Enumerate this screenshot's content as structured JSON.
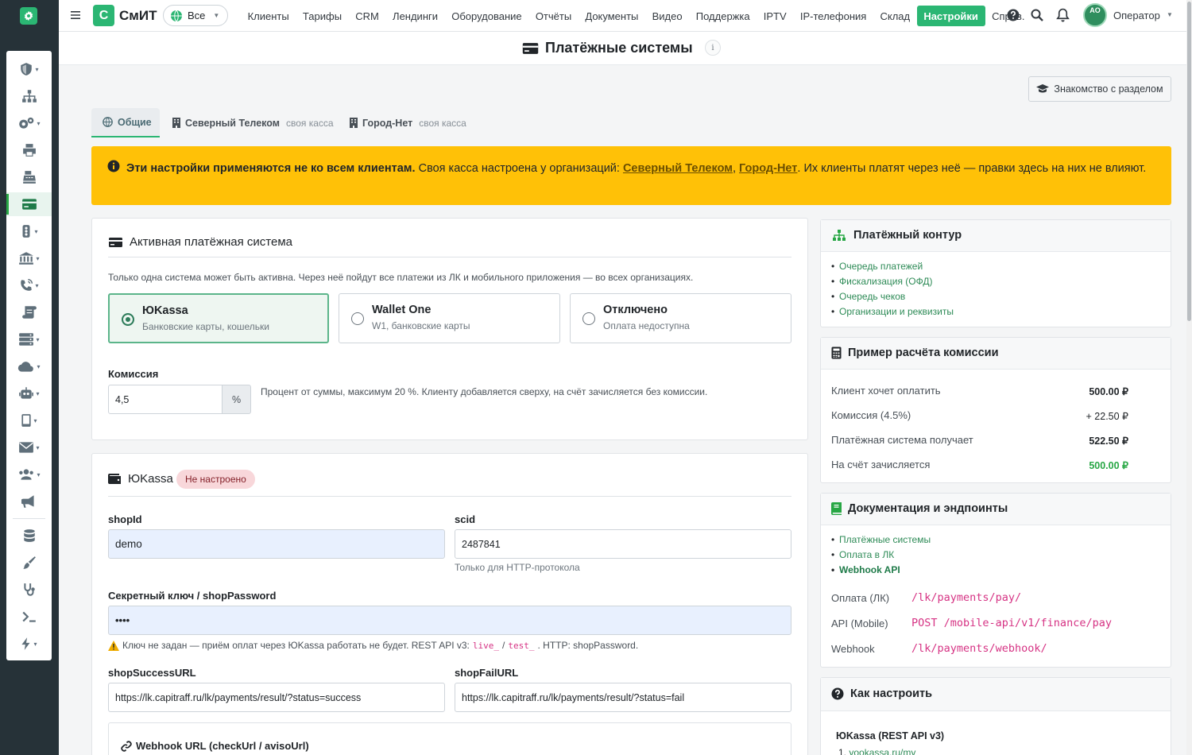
{
  "app": {
    "brand_letter": "С",
    "brand_name": "СмИТ",
    "scope": "Все"
  },
  "nav": [
    "Клиенты",
    "Тарифы",
    "CRM",
    "Лендинги",
    "Оборудование",
    "Отчёты",
    "Документы",
    "Видео",
    "Поддержка",
    "IPTV",
    "IP-телефония",
    "Склад",
    "Настройки",
    "Справ."
  ],
  "nav_active": "Настройки",
  "user": {
    "initials": "AO",
    "name": "Оператор"
  },
  "page": {
    "title": "Платёжные системы",
    "info": "i",
    "intro_button": "Знакомство с разделом"
  },
  "tabs": [
    {
      "label": "Общие",
      "sub": ""
    },
    {
      "label": "Северный Телеком",
      "sub": "своя касса"
    },
    {
      "label": "Город-Нет",
      "sub": "своя касса"
    }
  ],
  "warning": {
    "bold": "Эти настройки применяются не ко всем клиентам.",
    "text1": " Своя касса настроена у организаций: ",
    "org1": "Северный Телеком",
    "sep": ", ",
    "org2": "Город-Нет",
    "text2": ". Их клиенты платят через неё — правки здесь на них не влияют."
  },
  "active_system": {
    "title": "Активная платёжная система",
    "desc": "Только одна система может быть активна. Через неё пойдут все платежи из ЛК и мобильного приложения — во всех организациях.",
    "options": [
      {
        "title": "ЮKassa",
        "sub": "Банковские карты, кошельки",
        "selected": true
      },
      {
        "title": "Wallet One",
        "sub": "W1, банковские карты",
        "selected": false
      },
      {
        "title": "Отключено",
        "sub": "Оплата недоступна",
        "selected": false
      }
    ],
    "commission_label": "Комиссия",
    "commission_value": "4,5",
    "commission_unit": "%",
    "commission_hint": "Процент от суммы, максимум 20 %. Клиенту добавляется сверху, на счёт зачисляется без комиссии."
  },
  "yookassa": {
    "title": "ЮKassa",
    "status": "Не настроено",
    "shopid_label": "shopId",
    "shopid_value": "demo",
    "scid_label": "scid",
    "scid_value": "2487841",
    "scid_hint": "Только для HTTP-протокола",
    "secret_label": "Секретный ключ / shopPassword",
    "secret_value": "••••",
    "secret_hint1": "Ключ не задан — приём оплат через ЮKassa работать не будет. REST API v3: ",
    "secret_code1": "live_",
    "secret_hint_sep": " / ",
    "secret_code2": "test_",
    "secret_hint2": ". HTTP: shopPassword.",
    "success_label": "shopSuccessURL",
    "success_value": "https://lk.capitraff.ru/lk/payments/result/?status=success",
    "fail_label": "shopFailURL",
    "fail_value": "https://lk.capitraff.ru/lk/payments/result/?status=fail",
    "webhook_label": "Webhook URL (checkUrl / avisoUrl)"
  },
  "contour": {
    "title": "Платёжный контур",
    "links": [
      "Очередь платежей",
      "Фискализация (ОФД)",
      "Очередь чеков",
      "Организации и реквизиты"
    ]
  },
  "calc": {
    "title": "Пример расчёта комиссии",
    "rows": [
      {
        "label": "Клиент хочет оплатить",
        "value": "500.00 ₽"
      },
      {
        "label": "Комиссия (4.5%)",
        "value": "+ 22.50 ₽"
      },
      {
        "label": "Платёжная система получает",
        "value": "522.50 ₽"
      },
      {
        "label": "На счёт зачисляется",
        "value": "500.00 ₽"
      }
    ]
  },
  "docs": {
    "title": "Документация и эндпоинты",
    "links": [
      "Платёжные системы",
      "Оплата в ЛК",
      "Webhook API"
    ],
    "endpoints": [
      {
        "label": "Оплата (ЛК)",
        "value": "/lk/payments/pay/"
      },
      {
        "label": "API (Mobile)",
        "value": "POST /mobile-api/v1/finance/pay"
      },
      {
        "label": "Webhook",
        "value": "/lk/payments/webhook/"
      }
    ]
  },
  "howto": {
    "title": "Как настроить",
    "subtitle": "ЮKassa (REST API v3)",
    "first_step": "yookassa.ru/my"
  },
  "colors": {
    "brand": "#2bb673",
    "warning": "#ffc107",
    "rail": "#263238",
    "success_value": "#28a745",
    "code": "#d63384"
  }
}
